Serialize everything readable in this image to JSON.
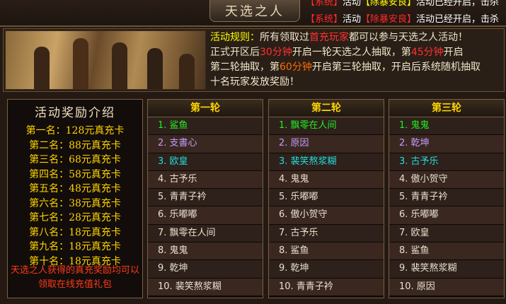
{
  "title": "天选之人",
  "system": {
    "line1_prefix": "【系统】",
    "line1_mid": "活动",
    "line1_event": "【除暴安良】",
    "line1_rest": "活动已经开启，击杀",
    "line2_prefix": "【系统】",
    "line2_mid": "活动",
    "line2_event": "【除暴安良】",
    "line2_rest": "活动已经开启，击杀"
  },
  "rules": {
    "label": "活动规则：",
    "t1": "所有领取过",
    "highlight1": "首充玩家",
    "t2": "都可以参与天选之人活动！",
    "t3": "正式开区后",
    "time1": "30分钟",
    "t4": "开启一轮天选之人抽取，第",
    "time2": "45分钟",
    "t5": "开启",
    "t6": "第二轮抽取，第",
    "time3": "60分钟",
    "t7": "开启第三轮抽取，开启后系统随机抽取",
    "t8": "十名玩家发放奖励！"
  },
  "reward": {
    "title": "活动奖励介绍",
    "items": [
      "第一名：128元真充卡",
      "第二名：88元真充卡",
      "第三名：68元真充卡",
      "第四名：58元真充卡",
      "第五名：48元真充卡",
      "第六名：38元真充卡",
      "第七名：28元真充卡",
      "第八名：18元真充卡",
      "第九名：18元真充卡",
      "第十名：18元真充卡"
    ],
    "note": "天选之人获得的真充奖励均可以领取在线充值礼包"
  },
  "rounds": [
    {
      "title": "第一轮",
      "rows": [
        "1. 鲨鱼",
        "2. 支書心",
        "3. 欧皇",
        "4. 古予乐",
        "5. 青青子衿",
        "6. 乐嘟嘟",
        "7. 飘零在人间",
        "8. 鬼鬼",
        "9. 乾坤",
        "10. 裴笑熬浆糊"
      ]
    },
    {
      "title": "第二轮",
      "rows": [
        "1. 飘零在人间",
        "2. 原因",
        "3. 裴笑熬浆糊",
        "4. 鬼鬼",
        "5. 乐嘟嘟",
        "6. 傲小贺守",
        "7. 古予乐",
        "8. 鲨鱼",
        "9. 乾坤",
        "10. 青青子衿"
      ]
    },
    {
      "title": "第三轮",
      "rows": [
        "1. 鬼鬼",
        "2. 乾坤",
        "3. 古予乐",
        "4. 傲小贺守",
        "5. 青青子衿",
        "6. 乐嘟嘟",
        "7. 欧皇",
        "8. 鲨鱼",
        "9. 裴笑熬浆糊",
        "10. 原因"
      ]
    }
  ],
  "colors": {
    "first": "#22ee22",
    "second": "#c39bff",
    "third": "#22dddd",
    "round_title": "#ffd400"
  }
}
